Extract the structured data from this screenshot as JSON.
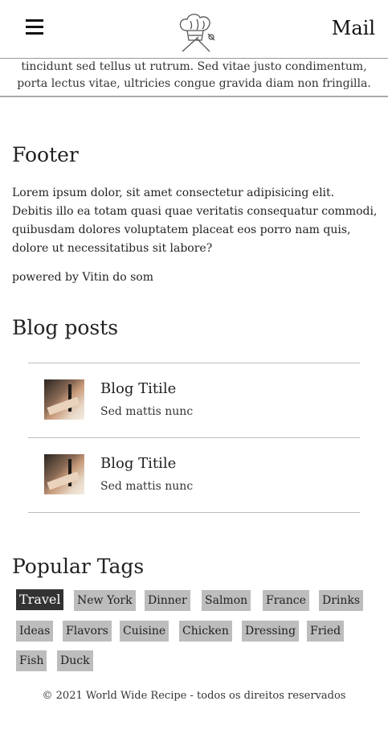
{
  "header": {
    "menu_icon": "hamburger-icon",
    "logo_icon": "chef-hat-utensils-logo",
    "mail_label": "Mail"
  },
  "strip": {
    "text": "tincidunt sed tellus ut rutrum. Sed vitae justo condimentum, porta lectus vitae, ultricies congue gravida diam non fringilla."
  },
  "footer": {
    "title": "Footer",
    "text": "Lorem ipsum dolor, sit amet consectetur adipisicing elit. Debitis illo ea totam quasi quae veritatis consequatur commodi, quibusdam dolores voluptatem placeat eos porro nam quis, dolore ut necessitatibus sit labore?",
    "powered": "powered by Vitin do som"
  },
  "blog": {
    "title": "Blog posts",
    "posts": [
      {
        "title": "Blog Titile",
        "subtitle": "Sed mattis nunc"
      },
      {
        "title": "Blog Titile",
        "subtitle": "Sed mattis nunc"
      }
    ]
  },
  "tags": {
    "title": "Popular Tags",
    "active": "Travel",
    "items": [
      "Travel",
      "New York",
      "Dinner",
      "Salmon",
      "France",
      "Drinks",
      "Ideas",
      "Flavors",
      "Cuisine",
      "Chicken",
      "Dressing",
      "Fried",
      "Fish",
      "Duck"
    ]
  },
  "copyright": "© 2021 World Wide Recipe - todos os direitos reservados",
  "colors": {
    "active_tag_bg": "#333333",
    "tag_bg": "#bdbdbd",
    "divider": "#bbbbbb"
  }
}
